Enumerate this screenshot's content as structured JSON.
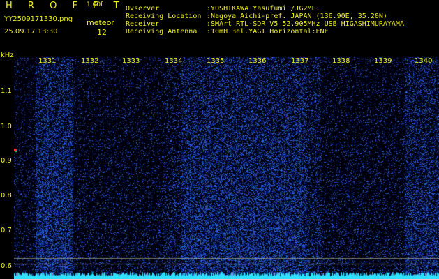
{
  "header": {
    "brand": "H R O F F T",
    "version": "1.00f",
    "filename": "YY2509171330.png",
    "mode": "meteor",
    "datetime": "25.09.17 13:30",
    "count": "12"
  },
  "info": [
    {
      "key": "Ovserver",
      "value": ":YOSHIKAWA Yasufumi /JG2MLI"
    },
    {
      "key": "Receiving Location",
      "value": ":Nagoya Aichi-pref. JAPAN (136.90E, 35.20N)"
    },
    {
      "key": "Receiver",
      "value": ":SMArt RTL-SDR V5 52.905MHz USB HIGASHIMURAYAMA"
    },
    {
      "key": "Receiving Antenna",
      "value": ":10mH 3el.YAGI Horizontal:ENE"
    }
  ],
  "axis": {
    "y_unit": "kHz",
    "y_ticks": [
      "1.1",
      "1.0",
      "0.9",
      "0.8",
      "0.7",
      "0.6"
    ],
    "x_ticks": [
      "1331",
      "1332",
      "1333",
      "1334",
      "1335",
      "1336",
      "1337",
      "1338",
      "1339",
      "1340"
    ]
  },
  "colors": {
    "background": "#000000",
    "label_yellow": "#f0f020",
    "label_green": "#40e060",
    "noise_blue": "#1838c8",
    "trace_cyan": "#30e0ff"
  }
}
